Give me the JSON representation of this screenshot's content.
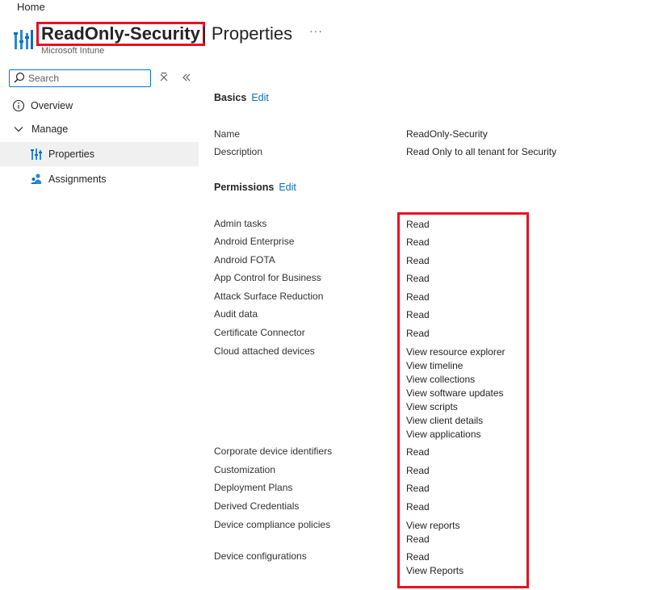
{
  "breadcrumb": "Home",
  "header": {
    "title_name": "ReadOnly-Security",
    "title_rest": "| Properties",
    "subtitle": "Microsoft Intune",
    "more": "···"
  },
  "sidebar": {
    "search_placeholder": "Search",
    "items": [
      {
        "label": "Overview"
      },
      {
        "label": "Manage"
      },
      {
        "label": "Properties"
      },
      {
        "label": "Assignments"
      }
    ]
  },
  "basics": {
    "heading": "Basics",
    "edit": "Edit",
    "name_label": "Name",
    "name_value": "ReadOnly-Security",
    "desc_label": "Description",
    "desc_value": "Read Only to all tenant for Security"
  },
  "permissions": {
    "heading": "Permissions",
    "edit": "Edit",
    "rows": [
      {
        "label": "Admin tasks",
        "values": [
          "Read"
        ]
      },
      {
        "label": "Android Enterprise",
        "values": [
          "Read"
        ]
      },
      {
        "label": "Android FOTA",
        "values": [
          "Read"
        ]
      },
      {
        "label": "App Control for Business",
        "values": [
          "Read"
        ]
      },
      {
        "label": "Attack Surface Reduction",
        "values": [
          "Read"
        ]
      },
      {
        "label": "Audit data",
        "values": [
          "Read"
        ]
      },
      {
        "label": "Certificate Connector",
        "values": [
          "Read"
        ]
      },
      {
        "label": "Cloud attached devices",
        "values": [
          "View resource explorer",
          "View timeline",
          "View collections",
          "View software updates",
          "View scripts",
          "View client details",
          "View applications"
        ]
      },
      {
        "label": "Corporate device identifiers",
        "values": [
          "Read"
        ]
      },
      {
        "label": "Customization",
        "values": [
          "Read"
        ]
      },
      {
        "label": "Deployment Plans",
        "values": [
          "Read"
        ]
      },
      {
        "label": "Derived Credentials",
        "values": [
          "Read"
        ]
      },
      {
        "label": "Device compliance policies",
        "values": [
          "View reports",
          "Read"
        ]
      },
      {
        "label": "Device configurations",
        "values": [
          "Read",
          "View Reports"
        ]
      }
    ]
  },
  "colors": {
    "accent": "#0f6cbd",
    "highlight": "#e81123",
    "selected_bg": "#f0f0f0"
  }
}
